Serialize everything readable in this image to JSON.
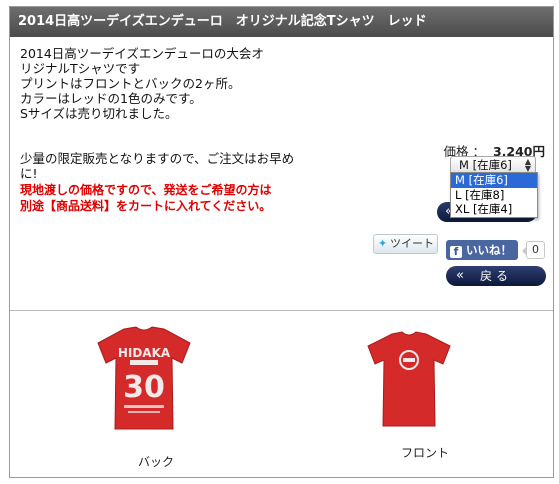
{
  "product": {
    "title": "2014日高ツーデイズエンデューロ　オリジナル記念Tシャツ　レッド",
    "description": [
      "2014日高ツーデイズエンデューロの大会オ",
      "リジナルTシャツです",
      "プリントはフロントとバックの2ヶ所。",
      "カラーはレッドの1色のみです。",
      "Sサイズは売り切れました。"
    ],
    "limited_note": "少量の限定販売となりますので、ご注文はお早めに!",
    "warning": "現地渡しの価格ですので、発送をご希望の方は別途【商品送料】をカートに入れてください。",
    "price_label": "価格 ：",
    "price_value": "3,240円"
  },
  "size_select": {
    "selected": "M [在庫6]",
    "options": [
      "M [在庫6]",
      "L [在庫8]",
      "XL [在庫4]"
    ]
  },
  "buttons": {
    "cart_icon": "«",
    "tweet_label": "ツイート",
    "like_label": "いいね！",
    "like_count": "0",
    "back_icon": "«",
    "back_label": "戻る"
  },
  "images": [
    {
      "caption": "バック",
      "print_top": "HIDAKA",
      "print_number": "30"
    },
    {
      "caption": "フロント"
    }
  ],
  "colors": {
    "title_bar": "#5a5a5a",
    "warning": "#e00000",
    "shirt": "#d42a2a",
    "button_navy": "#1a2754",
    "select_highlight": "#2b6ad6"
  }
}
